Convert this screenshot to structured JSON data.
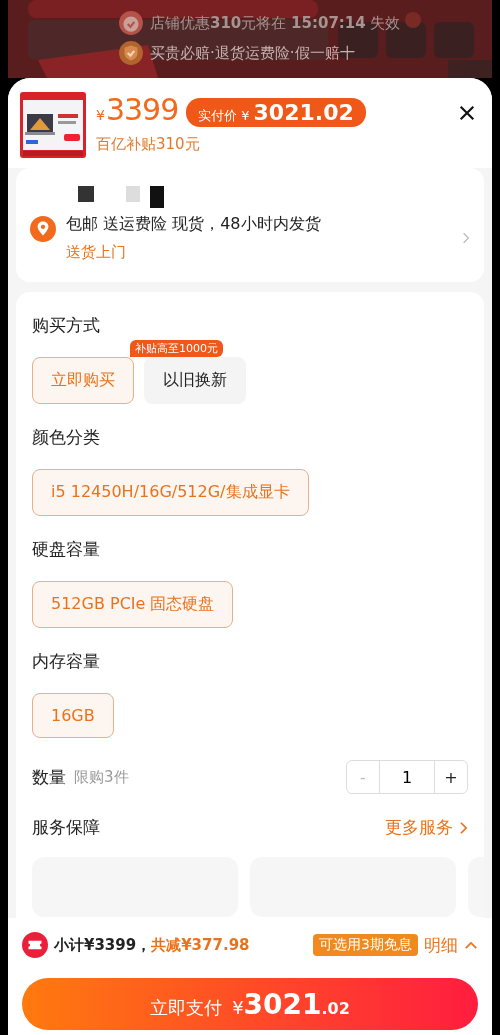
{
  "background": {
    "notices": [
      {
        "kind": "timer",
        "text": "店铺优惠**310**元将在 **15:07:14** 失效"
      },
      {
        "kind": "shield",
        "text": "买贵必赔·退货运费险·假一赔十"
      }
    ]
  },
  "product": {
    "price_symbol": "¥",
    "price": "3399",
    "badge_label": "实付价",
    "badge_symbol": "¥",
    "badge_price": "3021.02",
    "subsidy": "百亿补贴310元"
  },
  "delivery": {
    "info": "包邮 送运费险 现货，48小时内发货",
    "tag": "送货上门"
  },
  "option_groups": [
    {
      "title": "购买方式",
      "options": [
        {
          "label": "立即购买",
          "selected": true
        },
        {
          "label": "以旧换新",
          "selected": false,
          "badge": "补贴高至1000元"
        }
      ]
    },
    {
      "title": "颜色分类",
      "options": [
        {
          "label": "i5 12450H/16G/512G/集成显卡",
          "selected": true
        }
      ]
    },
    {
      "title": "硬盘容量",
      "options": [
        {
          "label": "512GB PCIe 固态硬盘",
          "selected": true
        }
      ]
    },
    {
      "title": "内存容量",
      "options": [
        {
          "label": "16GB",
          "selected": true
        }
      ]
    }
  ],
  "quantity": {
    "label": "数量",
    "limit": "限购3件",
    "minus": "-",
    "value": "1",
    "plus": "+",
    "minus_disabled": true
  },
  "services": {
    "title": "服务保障",
    "more": "更多服务"
  },
  "footer": {
    "subtotal": "小计¥3399，",
    "discount": "共减¥377.98",
    "installment": "可选用3期免息",
    "details": "明细"
  },
  "pay_button": {
    "label": "立即支付",
    "symbol": "¥",
    "integer": "3021",
    "decimal": ".02"
  }
}
